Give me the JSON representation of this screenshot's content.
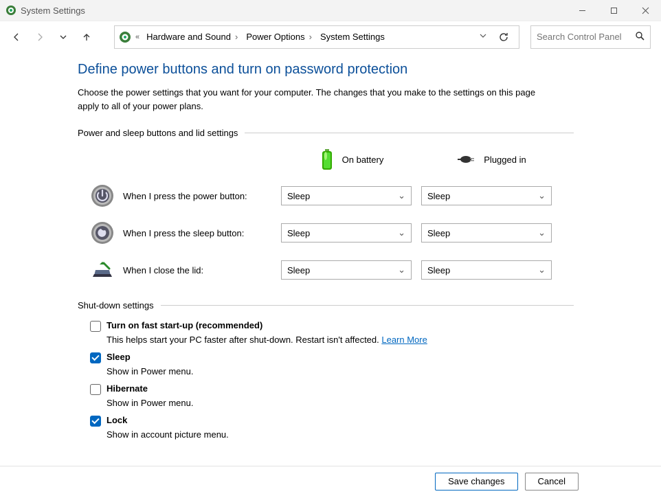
{
  "window": {
    "title": "System Settings"
  },
  "breadcrumb": {
    "item1": "Hardware and Sound",
    "item2": "Power Options",
    "item3": "System Settings"
  },
  "search": {
    "placeholder": "Search Control Panel"
  },
  "page": {
    "heading": "Define power buttons and turn on password protection",
    "description": "Choose the power settings that you want for your computer. The changes that you make to the settings on this page apply to all of your power plans."
  },
  "section1": {
    "title": "Power and sleep buttons and lid settings",
    "col_battery": "On battery",
    "col_plugged": "Plugged in",
    "row_power_label": "When I press the power button:",
    "row_power_battery": "Sleep",
    "row_power_plugged": "Sleep",
    "row_sleep_label": "When I press the sleep button:",
    "row_sleep_battery": "Sleep",
    "row_sleep_plugged": "Sleep",
    "row_lid_label": "When I close the lid:",
    "row_lid_battery": "Sleep",
    "row_lid_plugged": "Sleep"
  },
  "section2": {
    "title": "Shut-down settings",
    "faststartup_label": "Turn on fast start-up (recommended)",
    "faststartup_desc": "This helps start your PC faster after shut-down. Restart isn't affected. ",
    "learn_more": "Learn More",
    "sleep_label": "Sleep",
    "sleep_desc": "Show in Power menu.",
    "hibernate_label": "Hibernate",
    "hibernate_desc": "Show in Power menu.",
    "lock_label": "Lock",
    "lock_desc": "Show in account picture menu."
  },
  "footer": {
    "save": "Save changes",
    "cancel": "Cancel"
  }
}
